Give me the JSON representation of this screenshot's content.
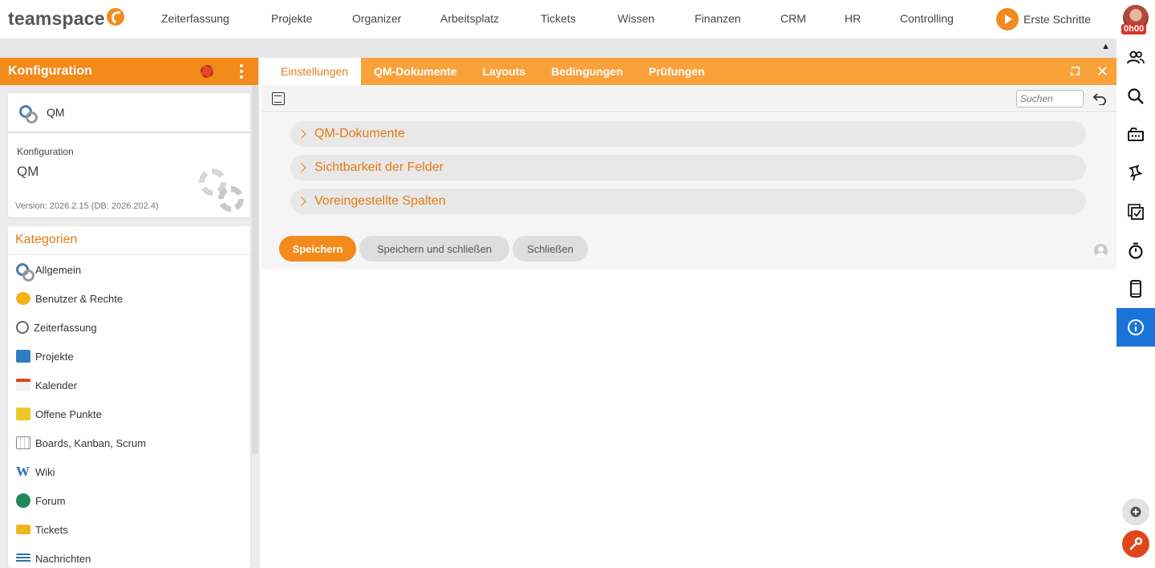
{
  "app": {
    "logo_text": "teamspace"
  },
  "nav": {
    "items": [
      "Zeiterfassung",
      "Projekte",
      "Organizer",
      "Arbeitsplatz",
      "Tickets",
      "Wissen",
      "Finanzen",
      "CRM",
      "HR",
      "Controlling"
    ],
    "first_steps": "Erste Schritte",
    "time_badge": "0h00"
  },
  "left": {
    "title": "Konfiguration",
    "qm_card": {
      "name": "QM",
      "sub_label": "Konfiguration",
      "big_label": "QM",
      "version": "Version: 2026.2.15 (DB: 2026.202.4)"
    },
    "categories_title": "Kategorien",
    "categories": [
      {
        "label": "Allgemein",
        "icon": "gears-icon"
      },
      {
        "label": "Benutzer & Rechte",
        "icon": "users-icon"
      },
      {
        "label": "Zeiterfassung",
        "icon": "stopwatch-icon"
      },
      {
        "label": "Projekte",
        "icon": "folder-icon"
      },
      {
        "label": "Kalender",
        "icon": "calendar-icon"
      },
      {
        "label": "Offene Punkte",
        "icon": "sticky-note-icon"
      },
      {
        "label": "Boards, Kanban, Scrum",
        "icon": "board-icon"
      },
      {
        "label": "Wiki",
        "icon": "wiki-icon"
      },
      {
        "label": "Forum",
        "icon": "forum-icon"
      },
      {
        "label": "Tickets",
        "icon": "ticket-icon"
      },
      {
        "label": "Nachrichten",
        "icon": "messages-icon"
      }
    ]
  },
  "main": {
    "tabs": [
      "Einstellungen",
      "QM-Dokumente",
      "Layouts",
      "Bedingungen",
      "Prüfungen"
    ],
    "active_tab": "Einstellungen",
    "search": {
      "placeholder": "Suchen",
      "value": ""
    },
    "sections": [
      "QM-Dokumente",
      "Sichtbarkeit der Felder",
      "Voreingestellte Spalten"
    ],
    "buttons": {
      "save": "Speichern",
      "save_close": "Speichern und schließen",
      "close": "Schließen"
    }
  },
  "colors": {
    "brand_orange": "#f28a1c",
    "tab_orange": "#f9a13a",
    "accent_text": "#e37b14",
    "active_blue": "#1a73d9",
    "danger_red": "#e0461c"
  },
  "rightbar": {
    "icons": [
      "contacts-icon",
      "search-icon",
      "inbox-icon",
      "pin-icon",
      "tasks-icon",
      "stopwatch-icon",
      "phone-icon",
      "info-icon"
    ],
    "active": "info-icon"
  }
}
